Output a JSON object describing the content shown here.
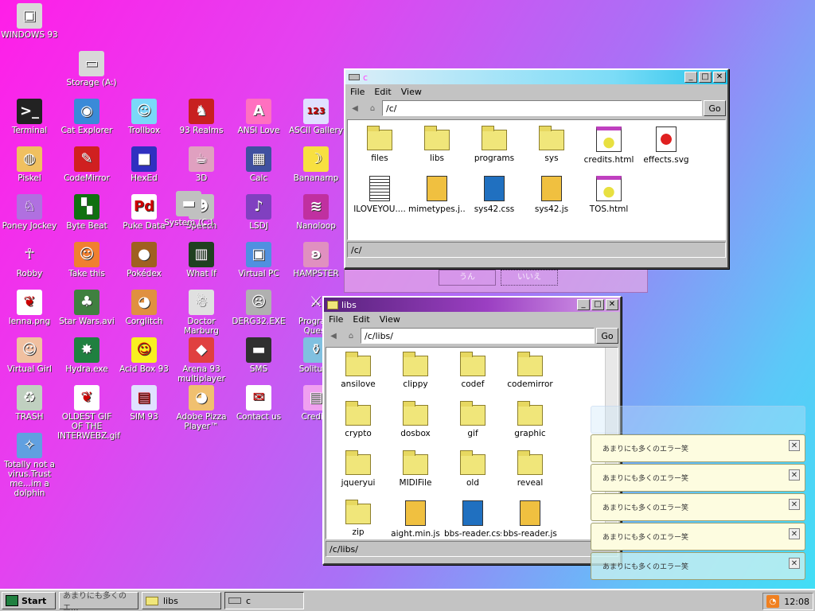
{
  "desktop_icons": [
    {
      "label": "WINDOWS 93",
      "icon": "computer-icon",
      "glyph": "▣",
      "bg": "#d8d8d8"
    },
    {
      "label": "Storage (A:)",
      "icon": "floppy-drive-icon",
      "glyph": "▭",
      "bg": "#d8d8d8"
    },
    {
      "label": "Terminal",
      "icon": "terminal-icon",
      "glyph": ">_",
      "bg": "#222"
    },
    {
      "label": "Cat Explorer",
      "icon": "globe-cat-icon",
      "glyph": "◉",
      "bg": "#3a8ad8"
    },
    {
      "label": "Trollbox",
      "icon": "chat-bubble-icon",
      "glyph": "☺",
      "bg": "#7ad8f8"
    },
    {
      "label": "93 Realms",
      "icon": "knight-icon",
      "glyph": "♞",
      "bg": "#c82020"
    },
    {
      "label": "ANSI Love",
      "icon": "ansi-letter-icon",
      "glyph": "A",
      "bg": "#ff70c0"
    },
    {
      "label": "ASCII Gallery",
      "icon": "numbers-icon",
      "glyph": "123",
      "bg": "#e0e0ff"
    },
    {
      "label": "Piskel",
      "icon": "paint-palette-icon",
      "glyph": "◍",
      "bg": "#f0c060"
    },
    {
      "label": "CodeMirror",
      "icon": "codemirror-icon",
      "glyph": "✎",
      "bg": "#d02020"
    },
    {
      "label": "HexEd",
      "icon": "cube-icon",
      "glyph": "■",
      "bg": "#3030c0"
    },
    {
      "label": "3D",
      "icon": "teapot-icon",
      "glyph": "☕",
      "bg": "#e0a0c0"
    },
    {
      "label": "Calc",
      "icon": "calculator-icon",
      "glyph": "▦",
      "bg": "#4050a0"
    },
    {
      "label": "Bananamp",
      "icon": "banana-icon",
      "glyph": "☽",
      "bg": "#f8e040"
    },
    {
      "label": "Poney Jockey",
      "icon": "pony-icon",
      "glyph": "♘",
      "bg": "#b070e0"
    },
    {
      "label": "Byte Beat",
      "icon": "bytebeat-icon",
      "glyph": "▚",
      "bg": "#107010"
    },
    {
      "label": "Puke Data",
      "icon": "pd-icon",
      "glyph": "Pd",
      "bg": "#ffffff"
    },
    {
      "label": "Speech",
      "icon": "face-icon",
      "glyph": "☻",
      "bg": "#c0c0c0"
    },
    {
      "label": "LSDJ",
      "icon": "lsdj-icon",
      "glyph": "♪",
      "bg": "#8040c0"
    },
    {
      "label": "Nanoloop",
      "icon": "wave-icon",
      "glyph": "≋",
      "bg": "#c030a0"
    },
    {
      "label": "Robby",
      "icon": "stickman-icon",
      "glyph": "☥",
      "bg": "transparent"
    },
    {
      "label": "Take this",
      "icon": "pixel-character-icon",
      "glyph": "☺",
      "bg": "#f08030"
    },
    {
      "label": "Pokédex",
      "icon": "creature-icon",
      "glyph": "●",
      "bg": "#a06020"
    },
    {
      "label": "What If",
      "icon": "matrix-icon",
      "glyph": "▥",
      "bg": "#204020"
    },
    {
      "label": "Virtual PC",
      "icon": "virtual-pc-icon",
      "glyph": "▣",
      "bg": "#5090e0"
    },
    {
      "label": "HAMPSTER",
      "icon": "hamster-icon",
      "glyph": "ʚ",
      "bg": "#e090c0"
    },
    {
      "label": "lenna.png",
      "icon": "image-file-icon",
      "glyph": "❦",
      "bg": "#ffffff"
    },
    {
      "label": "Star Wars.avi",
      "icon": "yoda-icon",
      "glyph": "♣",
      "bg": "#408040"
    },
    {
      "label": "Corglitch",
      "icon": "corgi-icon",
      "glyph": "◕",
      "bg": "#e09040"
    },
    {
      "label": "Doctor Marburg",
      "icon": "doctor-icon",
      "glyph": "☃",
      "bg": "#e0e0e0"
    },
    {
      "label": "DERG32.EXE",
      "icon": "monitor-face-icon",
      "glyph": "☹",
      "bg": "#b0b0b0"
    },
    {
      "label": "Program Quest",
      "icon": "crossed-swords-icon",
      "glyph": "⚔",
      "bg": "transparent"
    },
    {
      "label": "Virtual Girl",
      "icon": "portrait-icon",
      "glyph": "☺",
      "bg": "#f0c0a0"
    },
    {
      "label": "Hydra.exe",
      "icon": "dragon-icon",
      "glyph": "✸",
      "bg": "#208040"
    },
    {
      "label": "Acid Box 93",
      "icon": "smiley-icon",
      "glyph": "☺",
      "bg": "#f8f020"
    },
    {
      "label": "Arena 93 multiplayer",
      "icon": "arena-cube-icon",
      "glyph": "◆",
      "bg": "#e04040"
    },
    {
      "label": "SMS",
      "icon": "sms-console-icon",
      "glyph": "▬",
      "bg": "#303030"
    },
    {
      "label": "Solitude",
      "icon": "bottle-icon",
      "glyph": "⚱",
      "bg": "#80c0e0"
    },
    {
      "label": "TRASH",
      "icon": "recycle-bin-icon",
      "glyph": "♻",
      "bg": "#c0d0c0"
    },
    {
      "label": "OLDEST GIF OF THE INTERWEBZ.gif",
      "icon": "gif-file-icon",
      "glyph": "❦",
      "bg": "#ffffff"
    },
    {
      "label": "SIM 93",
      "icon": "book-icon",
      "glyph": "▤",
      "bg": "#e0e0ff"
    },
    {
      "label": "Adobe Pizza Player™",
      "icon": "pizza-icon",
      "glyph": "◕",
      "bg": "#f0c070"
    },
    {
      "label": "Contact us",
      "icon": "envelope-pen-icon",
      "glyph": "✉",
      "bg": "#ffffff"
    },
    {
      "label": "Credits",
      "icon": "credits-icon",
      "glyph": "▤",
      "bg": "#f0a0f0"
    },
    {
      "label": "Totally not a virus.Trust me...im a dolphin",
      "icon": "dolphin-icon",
      "glyph": "✧",
      "bg": "#60a0e0"
    },
    {
      "label": "System (C:)",
      "icon": "hard-drive-icon",
      "glyph": "▬",
      "bg": "#c0c0c0"
    }
  ],
  "ghost_dialog": {
    "ok_label": "うん",
    "cancel_label": "いいえ"
  },
  "window_c": {
    "title": "c",
    "menu": [
      "File",
      "Edit",
      "View"
    ],
    "address": "/c/",
    "go_label": "Go",
    "status": "/c/",
    "items": [
      {
        "name": "files",
        "type": "folder"
      },
      {
        "name": "libs",
        "type": "folder"
      },
      {
        "name": "programs",
        "type": "folder"
      },
      {
        "name": "sys",
        "type": "folder"
      },
      {
        "name": "credits.html",
        "type": "html"
      },
      {
        "name": "effects.svg",
        "type": "svg"
      },
      {
        "name": "ILOVEYOU....",
        "type": "text"
      },
      {
        "name": "mimetypes.j...",
        "type": "js"
      },
      {
        "name": "sys42.css",
        "type": "css"
      },
      {
        "name": "sys42.js",
        "type": "js"
      },
      {
        "name": "TOS.html",
        "type": "html"
      }
    ]
  },
  "window_libs": {
    "title": "libs",
    "menu": [
      "File",
      "Edit",
      "View"
    ],
    "address": "/c/libs/",
    "go_label": "Go",
    "status": "/c/libs/",
    "items": [
      {
        "name": "ansilove",
        "type": "folder"
      },
      {
        "name": "clippy",
        "type": "folder"
      },
      {
        "name": "codef",
        "type": "folder"
      },
      {
        "name": "codemirror",
        "type": "folder"
      },
      {
        "name": "crypto",
        "type": "folder"
      },
      {
        "name": "dosbox",
        "type": "folder"
      },
      {
        "name": "gif",
        "type": "folder"
      },
      {
        "name": "graphic",
        "type": "folder"
      },
      {
        "name": "jqueryui",
        "type": "folder"
      },
      {
        "name": "MIDIFile",
        "type": "folder"
      },
      {
        "name": "old",
        "type": "folder"
      },
      {
        "name": "reveal",
        "type": "folder"
      },
      {
        "name": "zip",
        "type": "folder"
      },
      {
        "name": "aight.min.js",
        "type": "js"
      },
      {
        "name": "bbs-reader.css",
        "type": "css"
      },
      {
        "name": "bbs-reader.js",
        "type": "js"
      }
    ]
  },
  "notifications": [
    "あまりにも多くのエラー笑",
    "あまりにも多くのエラー笑",
    "あまりにも多くのエラー笑",
    "あまりにも多くのエラー笑",
    "あまりにも多くのエラー笑"
  ],
  "taskbar": {
    "start_label": "Start",
    "tasks": [
      {
        "label": "あまりにも多くのエ...",
        "icon": "none"
      },
      {
        "label": "libs",
        "icon": "folder-icon"
      },
      {
        "label": "c",
        "icon": "drive-icon"
      }
    ],
    "clock": "12:08",
    "tray_icon": "rss-icon"
  },
  "colors": {
    "folder": "#f0e67a",
    "js_file": "#f0c040",
    "css_file": "#2070c0",
    "accent_libs_title": "#59237e",
    "accent_c_title": "#27c4ea"
  }
}
